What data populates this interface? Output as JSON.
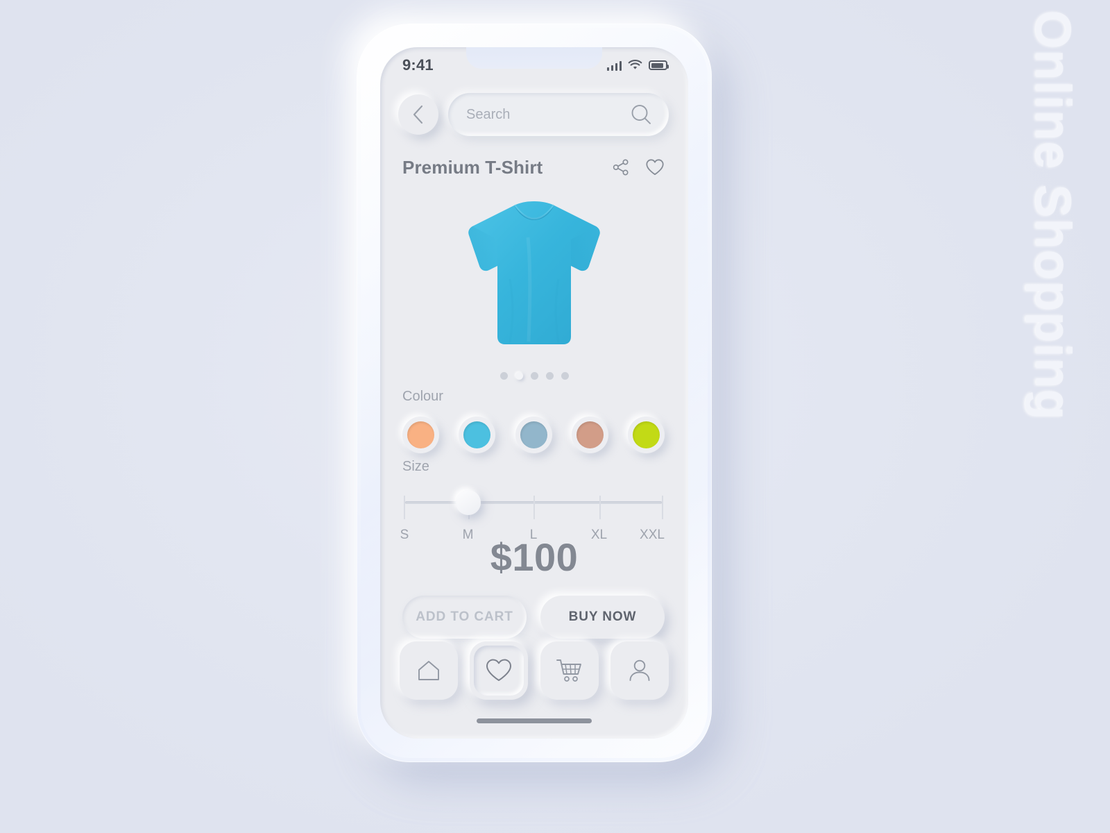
{
  "page": {
    "side_wordmark": "Online Shopping",
    "background_color": "#e2e6f1",
    "surface_color": "#ebecf0"
  },
  "statusbar": {
    "time": "9:41",
    "signal_icon": "signal-bars-icon",
    "wifi_icon": "wifi-icon",
    "battery_icon": "battery-icon"
  },
  "header": {
    "back_icon": "chevron-left-icon",
    "search_placeholder": "Search",
    "search_value": "",
    "search_icon": "search-icon"
  },
  "product": {
    "title": "Premium T-Shirt",
    "share_icon": "share-icon",
    "favourite_icon": "heart-icon",
    "image_icon": "tshirt-image",
    "shirt_color": "#3fb8dd"
  },
  "carousel": {
    "total": 5,
    "active_index": 1
  },
  "colour": {
    "label": "Colour",
    "selected_index": 1,
    "options": [
      {
        "name": "peach",
        "hex": "#f9b183"
      },
      {
        "name": "sky-blue",
        "hex": "#4cc0e0"
      },
      {
        "name": "steel-blue",
        "hex": "#92b6cb"
      },
      {
        "name": "dusty-rose",
        "hex": "#d29d88"
      },
      {
        "name": "lime",
        "hex": "#c2da16"
      }
    ]
  },
  "size": {
    "label": "Size",
    "options": [
      "S",
      "M",
      "L",
      "XL",
      "XXL"
    ],
    "selected": "M",
    "selected_index": 1
  },
  "price": {
    "value": "$100"
  },
  "actions": {
    "add_to_cart": "ADD TO CART",
    "buy_now": "BUY NOW"
  },
  "navbar": {
    "active_index": 1,
    "items": [
      {
        "name": "home",
        "icon": "home-icon"
      },
      {
        "name": "favourites",
        "icon": "heart-icon"
      },
      {
        "name": "cart",
        "icon": "cart-icon"
      },
      {
        "name": "profile",
        "icon": "person-icon"
      }
    ]
  }
}
